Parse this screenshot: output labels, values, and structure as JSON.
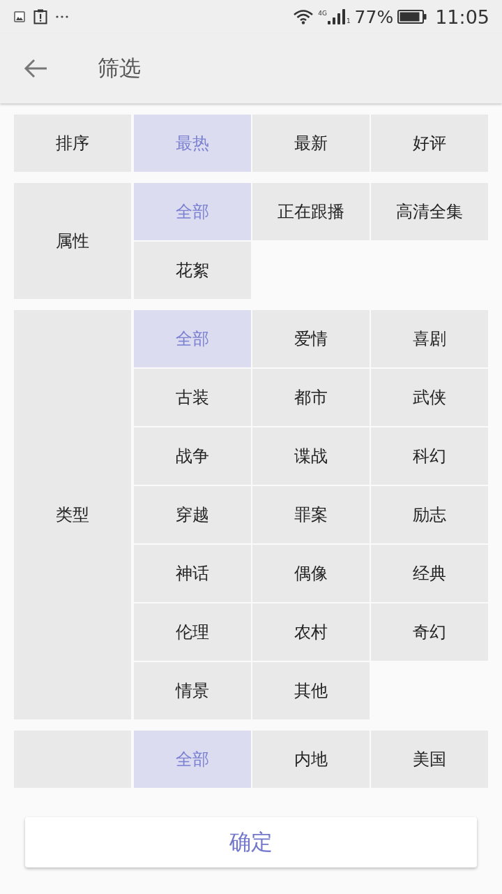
{
  "status_bar": {
    "network": "4G",
    "sim": "1",
    "battery": "77%",
    "time": "11:05"
  },
  "header": {
    "title": "筛选"
  },
  "filters": [
    {
      "label": "排序",
      "options": [
        {
          "text": "最热",
          "selected": true
        },
        {
          "text": "最新",
          "selected": false
        },
        {
          "text": "好评",
          "selected": false
        }
      ]
    },
    {
      "label": "属性",
      "options": [
        {
          "text": "全部",
          "selected": true
        },
        {
          "text": "正在跟播",
          "selected": false
        },
        {
          "text": "高清全集",
          "selected": false
        },
        {
          "text": "花絮",
          "selected": false
        }
      ]
    },
    {
      "label": "类型",
      "options": [
        {
          "text": "全部",
          "selected": true
        },
        {
          "text": "爱情",
          "selected": false
        },
        {
          "text": "喜剧",
          "selected": false
        },
        {
          "text": "古装",
          "selected": false
        },
        {
          "text": "都市",
          "selected": false
        },
        {
          "text": "武侠",
          "selected": false
        },
        {
          "text": "战争",
          "selected": false
        },
        {
          "text": "谍战",
          "selected": false
        },
        {
          "text": "科幻",
          "selected": false
        },
        {
          "text": "穿越",
          "selected": false
        },
        {
          "text": "罪案",
          "selected": false
        },
        {
          "text": "励志",
          "selected": false
        },
        {
          "text": "神话",
          "selected": false
        },
        {
          "text": "偶像",
          "selected": false
        },
        {
          "text": "经典",
          "selected": false
        },
        {
          "text": "伦理",
          "selected": false
        },
        {
          "text": "农村",
          "selected": false
        },
        {
          "text": "奇幻",
          "selected": false
        },
        {
          "text": "情景",
          "selected": false
        },
        {
          "text": "其他",
          "selected": false
        }
      ]
    },
    {
      "options": [
        {
          "text": "全部",
          "selected": true
        },
        {
          "text": "内地",
          "selected": false
        },
        {
          "text": "美国",
          "selected": false
        }
      ]
    }
  ],
  "confirm_button": {
    "label": "确定"
  }
}
